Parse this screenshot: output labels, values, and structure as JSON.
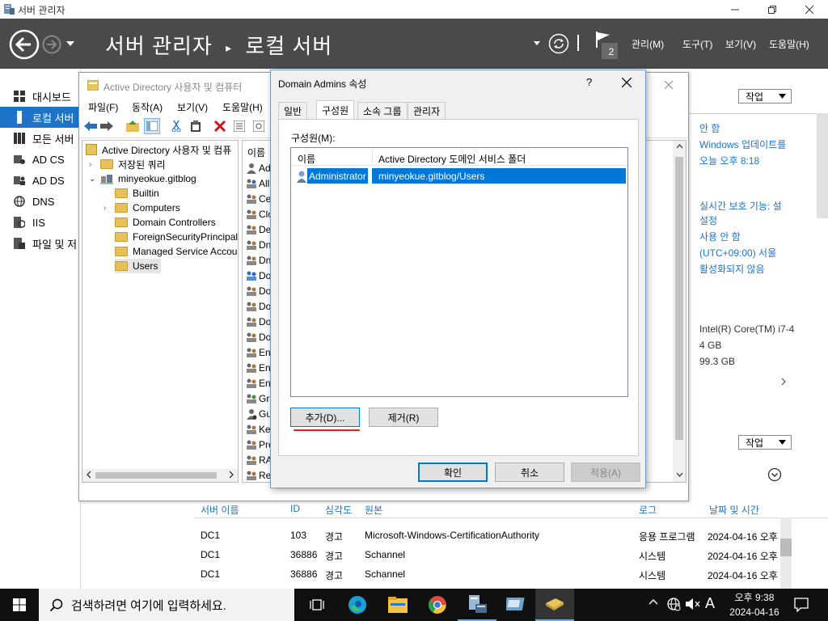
{
  "server_manager": {
    "window_title": "서버 관리자",
    "breadcrumb": [
      "서버 관리자",
      "로컬 서버"
    ],
    "notification_count": "2",
    "menus": [
      "관리(M)",
      "도구(T)",
      "보기(V)",
      "도움말(H)"
    ],
    "nav_items": [
      {
        "label": "대시보드",
        "icon": "dashboard-icon"
      },
      {
        "label": "로컬 서버",
        "icon": "local-server-icon",
        "active": true
      },
      {
        "label": "모든 서버",
        "icon": "all-servers-icon"
      },
      {
        "label": "AD CS",
        "icon": "ad-cs-icon"
      },
      {
        "label": "AD DS",
        "icon": "ad-ds-icon"
      },
      {
        "label": "DNS",
        "icon": "dns-icon"
      },
      {
        "label": "IIS",
        "icon": "iis-icon"
      },
      {
        "label": "파일 및 저",
        "icon": "file-storage-icon"
      }
    ],
    "task_button": "작업",
    "properties": [
      "안 함",
      "Windows 업데이트를",
      "오늘 오후 8:18",
      "실시간 보호 기능: 설",
      "설정",
      "사용 안 함",
      "(UTC+09:00) 서울",
      "활성화되지 않음"
    ],
    "hardware": [
      "Intel(R) Core(TM) i7-4",
      "4 GB",
      "99.3 GB"
    ],
    "events": {
      "columns": [
        "서버 이름",
        "ID",
        "심각도",
        "원본",
        "로그",
        "날짜 및 시간"
      ],
      "rows": [
        [
          "DC1",
          "103",
          "경고",
          "Microsoft-Windows-CertificationAuthority",
          "응용 프로그램",
          "2024-04-16 오후"
        ],
        [
          "DC1",
          "36886",
          "경고",
          "Schannel",
          "시스템",
          "2024-04-16 오후"
        ],
        [
          "DC1",
          "36886",
          "경고",
          "Schannel",
          "시스템",
          "2024-04-16 오후"
        ]
      ]
    }
  },
  "ad_window": {
    "title": "Active Directory 사용자 및 컴퓨터",
    "menus": [
      "파일(F)",
      "동작(A)",
      "보기(V)",
      "도움말(H)"
    ],
    "tree_root": "Active Directory 사용자 및 컴퓨",
    "tree": [
      {
        "label": "저장된 쿼리",
        "level": 1
      },
      {
        "label": "minyeokue.gitblog",
        "level": 1
      },
      {
        "label": "Builtin",
        "level": 2
      },
      {
        "label": "Computers",
        "level": 2
      },
      {
        "label": "Domain Controllers",
        "level": 2
      },
      {
        "label": "ForeignSecurityPrincipal",
        "level": 2
      },
      {
        "label": "Managed Service Accou",
        "level": 2
      },
      {
        "label": "Users",
        "level": 2,
        "selected": true
      }
    ],
    "list_header": "이름",
    "list_items": [
      "Ad",
      "All",
      "Ce",
      "Clo",
      "De",
      "Dn",
      "Dn",
      "Do",
      "Do",
      "Do",
      "Do",
      "Do",
      "En",
      "En",
      "En",
      "Gr",
      "Gu",
      "Ke",
      "Pro",
      "RA",
      "Re"
    ]
  },
  "dialog": {
    "title": "Domain Admins 속성",
    "help": "?",
    "tabs": [
      "일반",
      "구성원",
      "소속 그룹",
      "관리자"
    ],
    "members_label": "구성원(M):",
    "columns": [
      "이름",
      "Active Directory 도메인 서비스 폴더"
    ],
    "members": [
      {
        "name": "Administrator",
        "folder": "minyeokue.gitblog/Users"
      }
    ],
    "add_button": "추가(D)...",
    "remove_button": "제거(R)",
    "ok_button": "확인",
    "cancel_button": "취소",
    "apply_button": "적용(A)"
  },
  "taskbar": {
    "search_placeholder": "검색하려면 여기에 입력하세요.",
    "ime": "A",
    "time": "오후 9:38",
    "date": "2024-04-16"
  }
}
